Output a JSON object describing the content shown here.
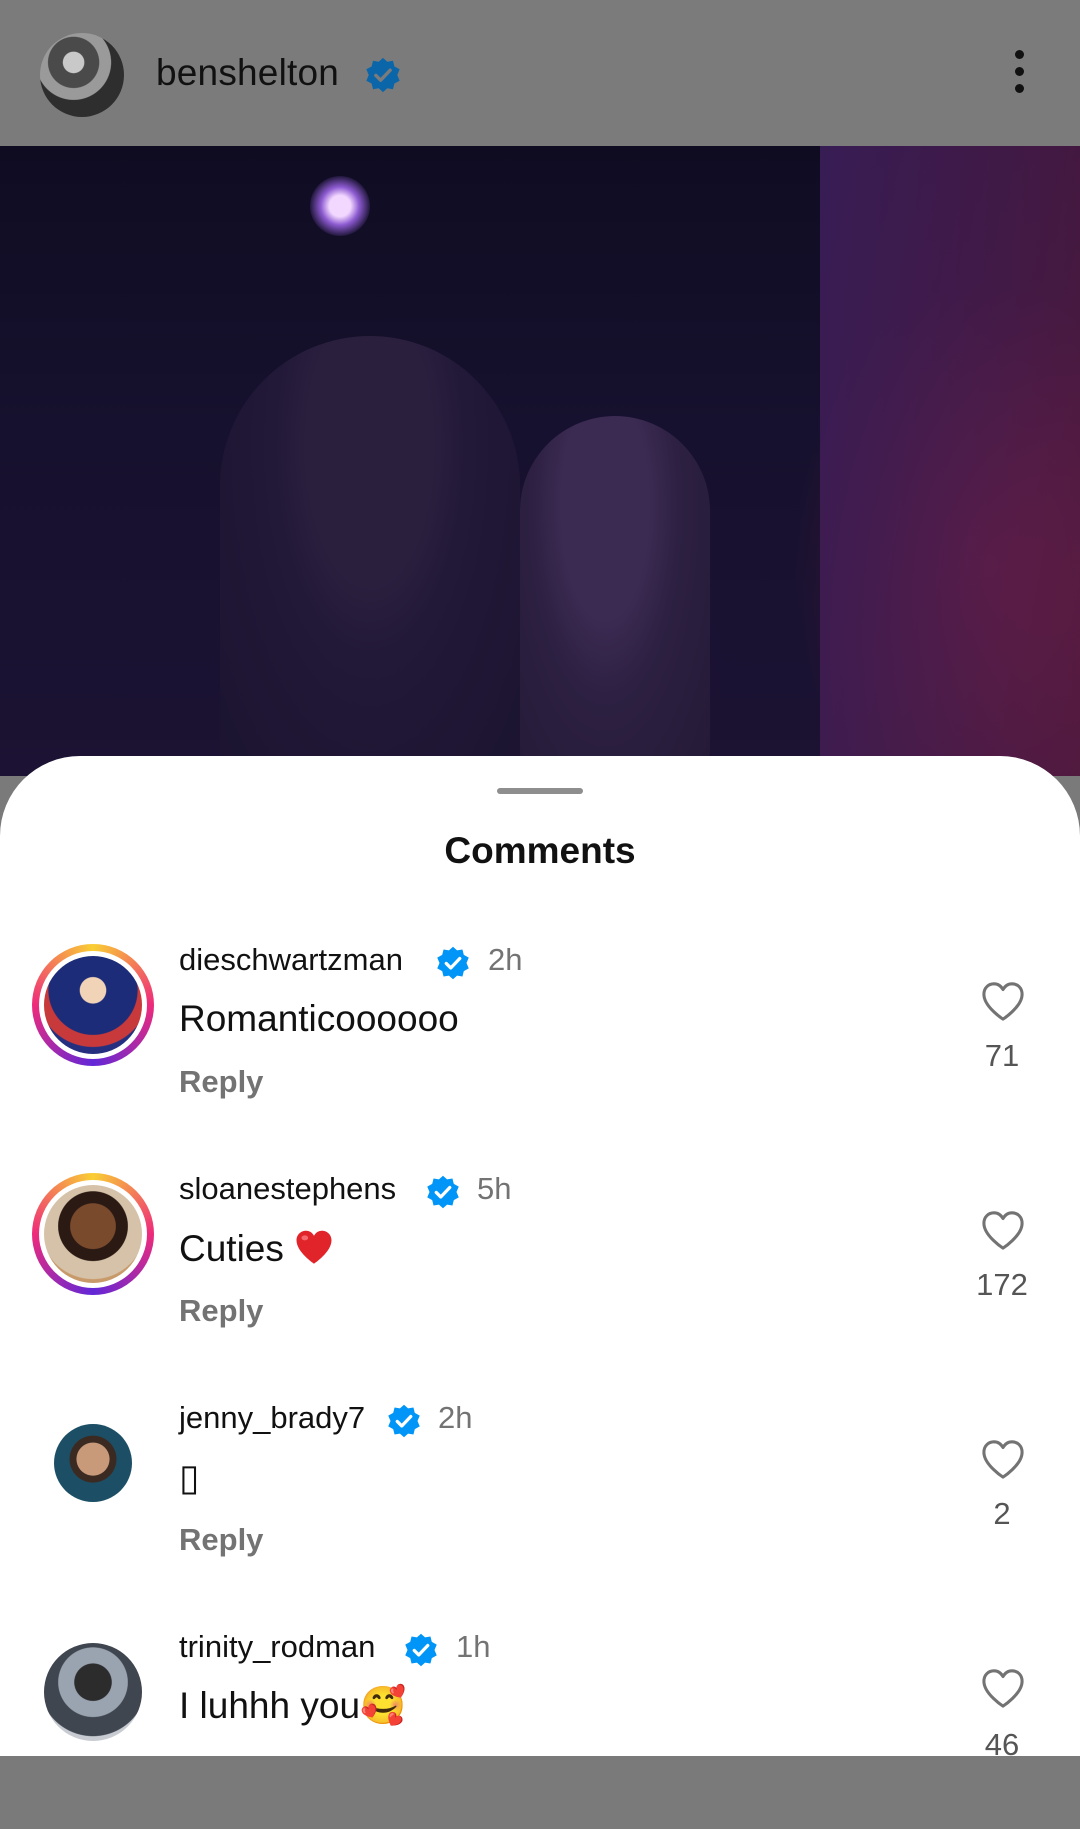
{
  "header": {
    "username": "benshelton",
    "verified": true
  },
  "sheet": {
    "title": "Comments"
  },
  "comments": [
    {
      "username": "dieschwartzman",
      "verified": true,
      "time": "2h",
      "text": "Romanticoooooo",
      "reply_label": "Reply",
      "likes": "71",
      "story_ring": true
    },
    {
      "username": "sloanestephens",
      "verified": true,
      "time": "5h",
      "text": "Cuties",
      "emoji": "red-heart",
      "reply_label": "Reply",
      "likes": "172",
      "story_ring": true
    },
    {
      "username": "jenny_brady7",
      "verified": true,
      "time": "2h",
      "text": "▯",
      "reply_label": "Reply",
      "likes": "2",
      "story_ring": false
    },
    {
      "username": "trinity_rodman",
      "verified": true,
      "time": "1h",
      "text": "I luhhh you🥰",
      "likes": "46",
      "story_ring": false
    }
  ],
  "colors": {
    "verified_blue": "#0095f6",
    "secondary_text": "#737373",
    "heart_red": "#e0242a"
  }
}
